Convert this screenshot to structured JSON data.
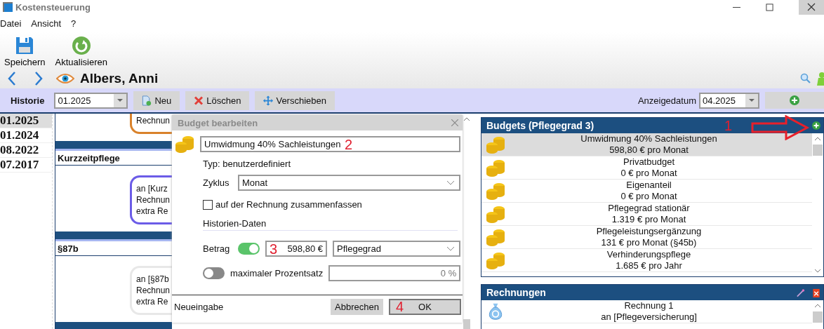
{
  "window": {
    "title": "Kostensteuerung"
  },
  "menu": [
    "Datei",
    "Ansicht",
    "?"
  ],
  "toolbar": [
    {
      "kind": "save",
      "label": "Speichern"
    },
    {
      "kind": "refresh",
      "label": "Aktualisieren"
    }
  ],
  "person": {
    "name": "Albers, Anni"
  },
  "history_bar": {
    "label": "Historie",
    "value": "01.2025",
    "display_date_label": "Anzeigedatum",
    "display_date": "04.2025",
    "buttons": [
      {
        "kind": "new",
        "label": "Neu"
      },
      {
        "kind": "delete",
        "label": "Löschen"
      },
      {
        "kind": "move",
        "label": "Verschieben"
      }
    ]
  },
  "history_dates": [
    {
      "label": "01.2025",
      "selected": true
    },
    {
      "label": "01.2024",
      "selected": false
    },
    {
      "label": "08.2022",
      "selected": false
    },
    {
      "label": "07.2017",
      "selected": false
    }
  ],
  "timeline": [
    {
      "kind": "card",
      "color": "#d9822b",
      "lines": [
        "Rechnun"
      ]
    },
    {
      "kind": "section",
      "title": "Kurzzeitpflege"
    },
    {
      "kind": "card",
      "color": "#6b5ce7",
      "lines": [
        "an [Kurz",
        "Rechnun",
        "extra Re"
      ]
    },
    {
      "kind": "section",
      "title": "§87b"
    },
    {
      "kind": "card",
      "color": "#e8e8e8",
      "lines": [
        "an [§87b",
        "Rechnun",
        "extra Re"
      ]
    },
    {
      "kind": "section"
    }
  ],
  "dialog": {
    "title": "Budget bearbeiten",
    "name": "Umwidmung 40% Sachleistungen",
    "name_marker": "2",
    "type": "Typ: benutzerdefiniert",
    "cycle": {
      "label": "Zyklus",
      "value": "Monat"
    },
    "summarize": {
      "label": "auf der Rechnung zusammenfassen",
      "checked": false
    },
    "section": "Historien-Daten",
    "amount": {
      "label": "Betrag",
      "on": true,
      "value": "598,80 €",
      "marker": "3",
      "basis": "Pflegegrad"
    },
    "max_percent": {
      "label": "maximaler Prozentsatz",
      "on": false,
      "value": "0 %"
    },
    "footer": "Neueingabe",
    "buttons": [
      {
        "label": "Abbrechen"
      },
      {
        "label": "OK",
        "marker": "4"
      }
    ]
  },
  "budgets": {
    "title": "Budgets (Pflegegrad 3)",
    "marker": "1",
    "items": [
      {
        "name": "Umwidmung 40% Sachleistungen",
        "detail": "598,80 € pro Monat",
        "selected": true
      },
      {
        "name": "Privatbudget",
        "detail": "0 € pro Monat",
        "selected": false
      },
      {
        "name": "Eigenanteil",
        "detail": "0 € pro Monat",
        "selected": false
      },
      {
        "name": "Pflegegrad stationär",
        "detail": "1.319 € pro Monat",
        "selected": false
      },
      {
        "name": "Pflegeleistungsergänzung",
        "detail": "131 € pro Monat (§45b)",
        "selected": false
      },
      {
        "name": "Verhinderungspflege",
        "detail": "1.685 € pro Jahr",
        "selected": false
      }
    ]
  },
  "invoices": {
    "title": "Rechnungen",
    "items": [
      {
        "name": "Rechnung 1",
        "detail": "an [Pflegeversicherung]"
      }
    ]
  }
}
